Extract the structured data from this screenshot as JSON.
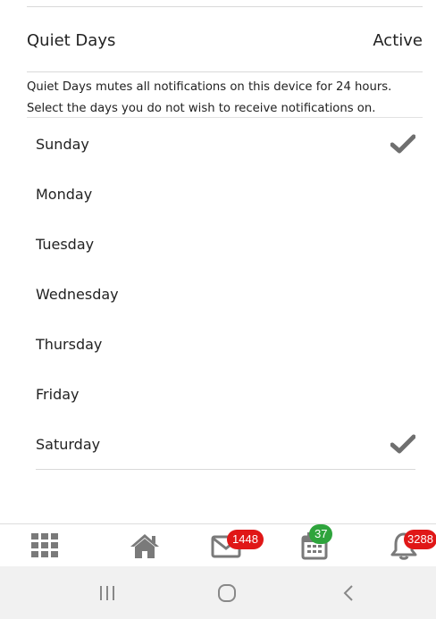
{
  "header": {
    "title": "Quiet Days",
    "status": "Active"
  },
  "description": {
    "line1": "Quiet Days mutes all notifications on this device for 24 hours.",
    "line2": "Select the days you do not wish to receive notifications on."
  },
  "days": [
    {
      "label": "Sunday",
      "checked": true
    },
    {
      "label": "Monday",
      "checked": false
    },
    {
      "label": "Tuesday",
      "checked": false
    },
    {
      "label": "Wednesday",
      "checked": false
    },
    {
      "label": "Thursday",
      "checked": false
    },
    {
      "label": "Friday",
      "checked": false
    },
    {
      "label": "Saturday",
      "checked": true
    }
  ],
  "tabbar": {
    "items": [
      {
        "icon": "grid-icon"
      },
      {
        "icon": "home-icon"
      },
      {
        "icon": "mail-icon",
        "badge": "1448",
        "badge_color": "#e01717"
      },
      {
        "icon": "calendar-icon",
        "badge": "37",
        "badge_color": "#2ea43c"
      },
      {
        "icon": "bell-icon",
        "badge": "3288",
        "badge_color": "#e01717"
      }
    ]
  },
  "system_nav": {
    "items": [
      "recents-button",
      "home-button",
      "back-button"
    ]
  },
  "colors": {
    "text": "#222222",
    "icon_gray": "#7a7a7a",
    "checkmark": "#6f6f6f",
    "divider": "#d9d9d9"
  }
}
